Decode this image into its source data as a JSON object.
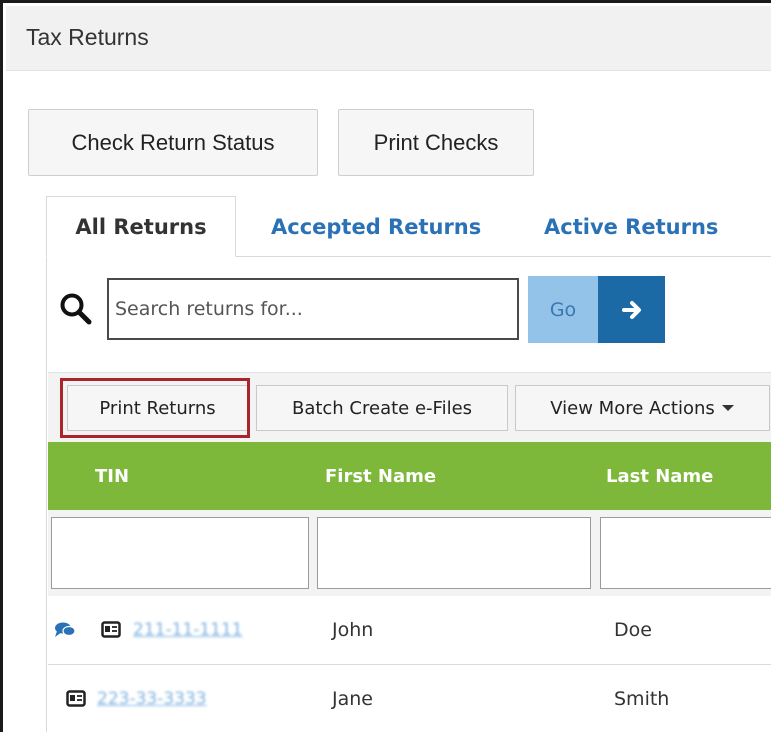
{
  "window": {
    "title": "Tax Returns"
  },
  "toolbar": {
    "check_status_label": "Check Return Status",
    "print_checks_label": "Print Checks"
  },
  "tabs": [
    {
      "label": "All Returns",
      "active": true
    },
    {
      "label": "Accepted Returns",
      "active": false
    },
    {
      "label": "Active Returns",
      "active": false
    }
  ],
  "search": {
    "placeholder": "Search returns for...",
    "value": "",
    "go_label": "Go"
  },
  "actions": {
    "print_returns_label": "Print Returns",
    "batch_create_label": "Batch Create e-Files",
    "more_actions_label": "View More Actions"
  },
  "table": {
    "columns": [
      "TIN",
      "First Name",
      "Last Name"
    ],
    "rows": [
      {
        "tin": "211-11-1111",
        "first_name": "John",
        "last_name": "Doe",
        "has_comment": true
      },
      {
        "tin": "223-33-3333",
        "first_name": "Jane",
        "last_name": "Smith",
        "has_comment": false
      }
    ]
  },
  "colors": {
    "header_green": "#7eb83a",
    "link_blue": "#2a72b5",
    "go_light_blue": "#93c3e8",
    "arrow_dark_blue": "#1b6aa5",
    "highlight_red": "#a8262a"
  },
  "icons": {
    "search": "search-icon",
    "arrow": "arrow-right-icon",
    "caret": "caret-down-icon",
    "comment": "comment-icon",
    "return_card": "id-card-icon"
  }
}
